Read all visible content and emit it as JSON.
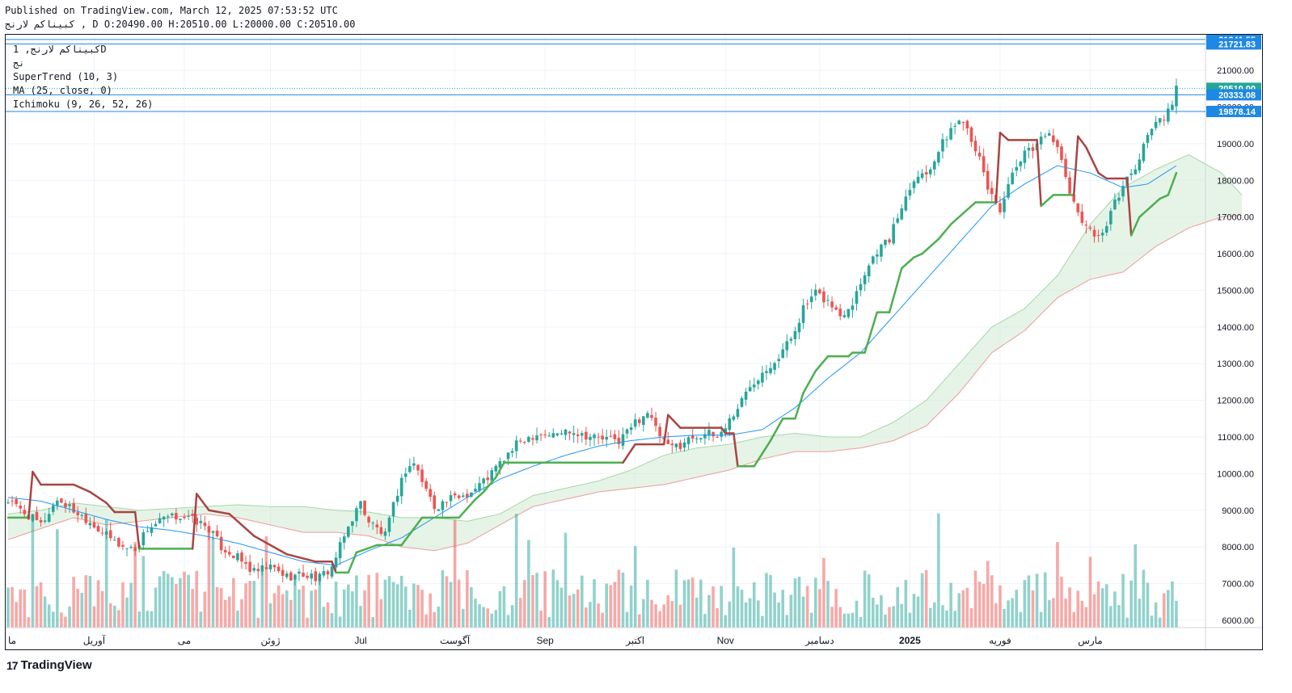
{
  "header": {
    "published": "Published on TradingView.com, March 12, 2025 07:53:52 UTC",
    "ohlc": "کبیناکم لارنج , D O:20490.00 H:20510.00 L:20000.00 C:20510.00"
  },
  "legend": {
    "symbol": "کبیناکم لارنج, 1D",
    "exchange": "نج",
    "supertrend": "SuperTrend (10, 3)",
    "ma": "MA (25, close, 0)",
    "ichimoku": "Ichimoku (9, 26, 52, 26)"
  },
  "footer": {
    "brand": "TradingView",
    "logo_icon": "tradingview-logo-icon"
  },
  "colors": {
    "up": "#26a69a",
    "down": "#ef5350",
    "supertrend_up": "#4caf50",
    "supertrend_down": "#a94442",
    "ma": "#2196f3",
    "cloud_fill": "#c8e6c9",
    "price_line": "#1e88e5"
  },
  "chart_data": {
    "type": "candlestick",
    "title": "",
    "yaxis": {
      "ticks": [
        6000,
        7000,
        8000,
        9000,
        10000,
        11000,
        12000,
        13000,
        14000,
        15000,
        16000,
        17000,
        18000,
        19000,
        20000,
        21000
      ],
      "tick_labels": [
        "6000.00",
        "7000.00",
        "8000.00",
        "9000.00",
        "10000.00",
        "11000.00",
        "12000.00",
        "13000.00",
        "14000.00",
        "15000.00",
        "16000.00",
        "17000.00",
        "18000.00",
        "19000.00",
        "20000.00",
        "21000.00"
      ],
      "range": [
        5800,
        21950
      ]
    },
    "xaxis": {
      "labels": [
        "ما",
        "آوریل",
        "می",
        "ژوئن",
        "Jul",
        "آگوست",
        "Sep",
        "اکتبر",
        "Nov",
        "دسامبر",
        "2025",
        "فوریه",
        "مارس"
      ],
      "label_positions_bar": [
        0,
        21,
        43,
        64,
        86,
        109,
        131,
        153,
        175,
        198,
        220,
        242,
        264
      ]
    },
    "price_levels": [
      {
        "label": "21841.55",
        "value": 21841.55,
        "color": "#1e88e5"
      },
      {
        "label": "21721.83",
        "value": 21721.83,
        "color": "#1e88e5"
      },
      {
        "label": "20510.00",
        "value": 20510.0,
        "color": "#26a69a"
      },
      {
        "label": "20333.08",
        "value": 20333.08,
        "color": "#1e88e5"
      },
      {
        "label": "19878.14",
        "value": 19878.14,
        "color": "#1e88e5"
      }
    ],
    "close_key": [
      [
        0,
        9250
      ],
      [
        5,
        8850
      ],
      [
        8,
        8600
      ],
      [
        12,
        9300
      ],
      [
        16,
        9000
      ],
      [
        20,
        8700
      ],
      [
        24,
        8300
      ],
      [
        28,
        8000
      ],
      [
        31,
        7950
      ],
      [
        34,
        8500
      ],
      [
        38,
        8750
      ],
      [
        42,
        8850
      ],
      [
        46,
        8700
      ],
      [
        49,
        8500
      ],
      [
        52,
        8000
      ],
      [
        56,
        7700
      ],
      [
        60,
        7300
      ],
      [
        64,
        7450
      ],
      [
        68,
        7200
      ],
      [
        72,
        7250
      ],
      [
        76,
        7150
      ],
      [
        79,
        7450
      ],
      [
        81,
        8000
      ],
      [
        84,
        8800
      ],
      [
        86,
        9200
      ],
      [
        88,
        8700
      ],
      [
        92,
        8300
      ],
      [
        95,
        9500
      ],
      [
        97,
        10100
      ],
      [
        99,
        10300
      ],
      [
        101,
        9800
      ],
      [
        104,
        9100
      ],
      [
        108,
        9300
      ],
      [
        113,
        9500
      ],
      [
        117,
        9900
      ],
      [
        121,
        10400
      ],
      [
        125,
        10900
      ],
      [
        129,
        11100
      ],
      [
        133,
        11050
      ],
      [
        137,
        11200
      ],
      [
        141,
        11050
      ],
      [
        145,
        10950
      ],
      [
        149,
        10900
      ],
      [
        153,
        11400
      ],
      [
        156,
        11700
      ],
      [
        158,
        11200
      ],
      [
        161,
        10700
      ],
      [
        164,
        10800
      ],
      [
        167,
        11000
      ],
      [
        170,
        11100
      ],
      [
        173,
        11000
      ],
      [
        175,
        11300
      ],
      [
        178,
        11800
      ],
      [
        181,
        12400
      ],
      [
        184,
        12800
      ],
      [
        188,
        13200
      ],
      [
        191,
        13700
      ],
      [
        194,
        14500
      ],
      [
        197,
        14900
      ],
      [
        200,
        14700
      ],
      [
        203,
        14300
      ],
      [
        206,
        14700
      ],
      [
        209,
        15500
      ],
      [
        212,
        16100
      ],
      [
        215,
        16400
      ],
      [
        218,
        17300
      ],
      [
        221,
        18100
      ],
      [
        224,
        18200
      ],
      [
        227,
        18800
      ],
      [
        230,
        19400
      ],
      [
        233,
        19700
      ],
      [
        236,
        18900
      ],
      [
        239,
        17800
      ],
      [
        242,
        17200
      ],
      [
        245,
        18100
      ],
      [
        248,
        18700
      ],
      [
        251,
        19000
      ],
      [
        254,
        19400
      ],
      [
        257,
        18500
      ],
      [
        260,
        17300
      ],
      [
        263,
        16800
      ],
      [
        266,
        16400
      ],
      [
        269,
        17100
      ],
      [
        272,
        17900
      ],
      [
        275,
        18300
      ],
      [
        278,
        19300
      ],
      [
        281,
        19600
      ],
      [
        284,
        20000
      ],
      [
        285,
        20510
      ]
    ],
    "supertrend": [
      [
        0,
        8800
      ],
      [
        5,
        8800
      ],
      [
        6,
        10050
      ],
      [
        8,
        9700
      ],
      [
        16,
        9700
      ],
      [
        20,
        9500
      ],
      [
        24,
        9200
      ],
      [
        26,
        8950
      ],
      [
        31,
        8950
      ],
      [
        32,
        7950
      ],
      [
        45,
        7950
      ],
      [
        46,
        9450
      ],
      [
        49,
        9000
      ],
      [
        54,
        8900
      ],
      [
        60,
        8300
      ],
      [
        68,
        7800
      ],
      [
        75,
        7600
      ],
      [
        79,
        7600
      ],
      [
        80,
        7300
      ],
      [
        83,
        7300
      ],
      [
        85,
        7850
      ],
      [
        90,
        8050
      ],
      [
        96,
        8050
      ],
      [
        99,
        8500
      ],
      [
        101,
        8800
      ],
      [
        110,
        8800
      ],
      [
        114,
        9300
      ],
      [
        116,
        9500
      ],
      [
        119,
        9900
      ],
      [
        121,
        10300
      ],
      [
        150,
        10300
      ],
      [
        153,
        10800
      ],
      [
        160,
        10800
      ],
      [
        161,
        11600
      ],
      [
        164,
        11250
      ],
      [
        174,
        11250
      ],
      [
        175,
        11100
      ],
      [
        177,
        11100
      ],
      [
        178,
        10200
      ],
      [
        182,
        10200
      ],
      [
        186,
        10900
      ],
      [
        189,
        11500
      ],
      [
        192,
        11500
      ],
      [
        194,
        12200
      ],
      [
        197,
        12800
      ],
      [
        200,
        13200
      ],
      [
        203,
        13200
      ],
      [
        205,
        13200
      ],
      [
        206,
        13300
      ],
      [
        209,
        13300
      ],
      [
        212,
        14400
      ],
      [
        215,
        14400
      ],
      [
        218,
        15600
      ],
      [
        221,
        15900
      ],
      [
        223,
        16000
      ],
      [
        227,
        16400
      ],
      [
        230,
        16800
      ],
      [
        233,
        17100
      ],
      [
        236,
        17400
      ],
      [
        241,
        17400
      ],
      [
        242,
        19300
      ],
      [
        244,
        19100
      ],
      [
        251,
        19100
      ],
      [
        252,
        17300
      ],
      [
        255,
        17600
      ],
      [
        260,
        17600
      ],
      [
        261,
        19200
      ],
      [
        263,
        18900
      ],
      [
        266,
        18200
      ],
      [
        268,
        18050
      ],
      [
        273,
        18050
      ],
      [
        274,
        16500
      ],
      [
        276,
        17000
      ],
      [
        279,
        17300
      ],
      [
        281,
        17500
      ],
      [
        283,
        17600
      ],
      [
        285,
        18200
      ]
    ],
    "supertrend_down_ranges": [
      [
        5,
        32
      ],
      [
        45,
        80
      ],
      [
        151,
        178
      ],
      [
        241,
        252
      ],
      [
        260,
        274
      ]
    ],
    "ma25": [
      [
        0,
        9350
      ],
      [
        8,
        9250
      ],
      [
        16,
        9000
      ],
      [
        24,
        8750
      ],
      [
        32,
        8550
      ],
      [
        40,
        8450
      ],
      [
        48,
        8300
      ],
      [
        56,
        8100
      ],
      [
        64,
        7850
      ],
      [
        72,
        7600
      ],
      [
        80,
        7500
      ],
      [
        88,
        7900
      ],
      [
        96,
        8250
      ],
      [
        104,
        8800
      ],
      [
        112,
        9350
      ],
      [
        120,
        9850
      ],
      [
        128,
        10200
      ],
      [
        136,
        10500
      ],
      [
        144,
        10750
      ],
      [
        152,
        10900
      ],
      [
        160,
        11000
      ],
      [
        168,
        11050
      ],
      [
        176,
        11050
      ],
      [
        184,
        11200
      ],
      [
        192,
        11800
      ],
      [
        200,
        12600
      ],
      [
        208,
        13300
      ],
      [
        216,
        14300
      ],
      [
        224,
        15300
      ],
      [
        232,
        16300
      ],
      [
        240,
        17300
      ],
      [
        248,
        17900
      ],
      [
        256,
        18400
      ],
      [
        264,
        18200
      ],
      [
        272,
        17800
      ],
      [
        278,
        17900
      ],
      [
        285,
        18400
      ]
    ],
    "cloud_upper": [
      [
        0,
        8900
      ],
      [
        8,
        9000
      ],
      [
        16,
        9200
      ],
      [
        24,
        9100
      ],
      [
        32,
        9000
      ],
      [
        40,
        9050
      ],
      [
        48,
        9100
      ],
      [
        56,
        9150
      ],
      [
        64,
        9100
      ],
      [
        72,
        9100
      ],
      [
        80,
        9000
      ],
      [
        88,
        8950
      ],
      [
        96,
        8800
      ],
      [
        104,
        8800
      ],
      [
        112,
        8700
      ],
      [
        120,
        8900
      ],
      [
        128,
        9400
      ],
      [
        136,
        9600
      ],
      [
        144,
        9800
      ],
      [
        152,
        10100
      ],
      [
        160,
        10500
      ],
      [
        168,
        10700
      ],
      [
        176,
        10800
      ],
      [
        184,
        11000
      ],
      [
        192,
        11100
      ],
      [
        200,
        11000
      ],
      [
        208,
        11000
      ],
      [
        216,
        11400
      ],
      [
        224,
        12000
      ],
      [
        232,
        13000
      ],
      [
        240,
        14000
      ],
      [
        248,
        14500
      ],
      [
        256,
        15400
      ],
      [
        264,
        16800
      ],
      [
        272,
        17800
      ],
      [
        280,
        18300
      ],
      [
        288,
        18700
      ],
      [
        296,
        18200
      ],
      [
        301,
        17600
      ]
    ],
    "cloud_lower": [
      [
        0,
        8200
      ],
      [
        8,
        8500
      ],
      [
        16,
        8800
      ],
      [
        24,
        8600
      ],
      [
        32,
        8700
      ],
      [
        40,
        8800
      ],
      [
        48,
        8900
      ],
      [
        56,
        8800
      ],
      [
        64,
        8600
      ],
      [
        72,
        8400
      ],
      [
        80,
        8400
      ],
      [
        88,
        8300
      ],
      [
        96,
        8000
      ],
      [
        104,
        7900
      ],
      [
        112,
        8100
      ],
      [
        120,
        8600
      ],
      [
        128,
        9100
      ],
      [
        136,
        9300
      ],
      [
        144,
        9500
      ],
      [
        152,
        9600
      ],
      [
        160,
        9700
      ],
      [
        168,
        9900
      ],
      [
        176,
        10100
      ],
      [
        184,
        10400
      ],
      [
        192,
        10600
      ],
      [
        200,
        10600
      ],
      [
        208,
        10700
      ],
      [
        216,
        10900
      ],
      [
        224,
        11300
      ],
      [
        232,
        12200
      ],
      [
        240,
        13300
      ],
      [
        248,
        13900
      ],
      [
        256,
        14800
      ],
      [
        264,
        15300
      ],
      [
        272,
        15500
      ],
      [
        280,
        16200
      ],
      [
        288,
        16700
      ],
      [
        296,
        17000
      ],
      [
        301,
        17050
      ]
    ]
  }
}
